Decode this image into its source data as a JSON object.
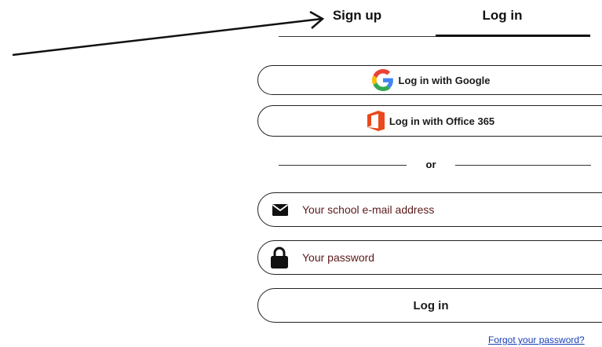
{
  "tabs": {
    "signup_label": "Sign up",
    "login_label": "Log in",
    "active": "login"
  },
  "auth_buttons": {
    "google_label": "Log in with Google",
    "office_label": "Log in with Office 365"
  },
  "divider": {
    "text": "or"
  },
  "form": {
    "email_placeholder": "Your school e-mail address",
    "password_placeholder": "Your password",
    "submit_label": "Log in"
  },
  "links": {
    "forgot_password": "Forgot your password?"
  },
  "icons": {
    "google": "google-icon",
    "office": "office365-icon",
    "email": "envelope-icon",
    "password": "lock-icon"
  },
  "colors": {
    "google_blue": "#4285F4",
    "google_red": "#EA4335",
    "google_yellow": "#FBBC05",
    "google_green": "#34A853",
    "office_orange": "#E8491D",
    "placeholder_text": "#5b1a1a",
    "link": "#1a3fb5"
  }
}
